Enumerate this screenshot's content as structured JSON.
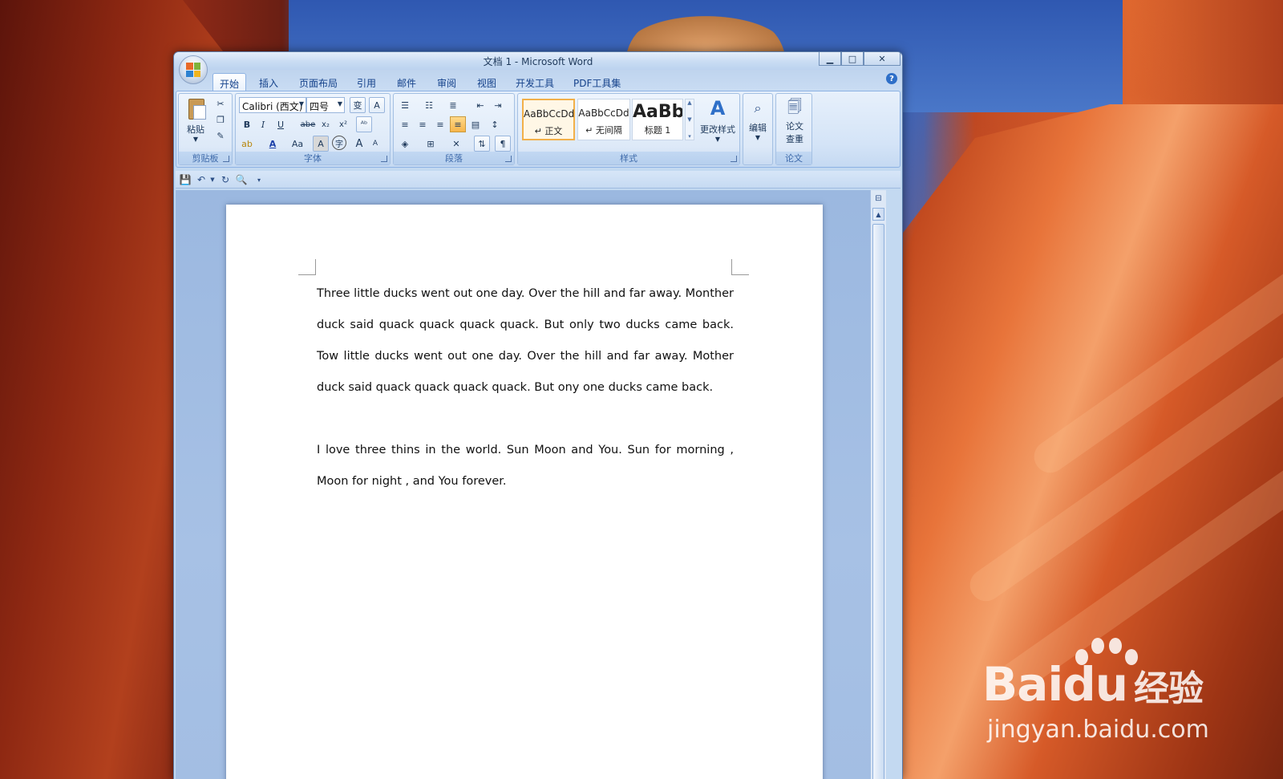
{
  "window": {
    "title": "文档 1 - Microsoft Word"
  },
  "window_controls": {
    "minimize": "▁",
    "maximize": "□",
    "close": "✕"
  },
  "tabs": [
    "开始",
    "插入",
    "页面布局",
    "引用",
    "邮件",
    "审阅",
    "视图",
    "开发工具",
    "PDF工具集"
  ],
  "ribbon": {
    "clipboard": {
      "paste_label": "粘贴",
      "group_label": "剪贴板"
    },
    "font": {
      "font_name": "Calibri (西文)",
      "font_size": "四号",
      "group_label": "字体",
      "bold": "B",
      "italic": "I",
      "underline": "U",
      "strike": "abe",
      "subscript": "x₂",
      "superscript": "x²",
      "font_color": "A",
      "change_case": "Aa",
      "char_shade": "A",
      "enclose": "字",
      "grow": "A",
      "shrink": "A"
    },
    "paragraph": {
      "group_label": "段落"
    },
    "styles": {
      "group_label": "样式",
      "items": [
        {
          "sample": "AaBbCcDd",
          "name": "↵ 正文"
        },
        {
          "sample": "AaBbCcDd",
          "name": "↵ 无间隔"
        },
        {
          "sample": "AaBb",
          "name": "标题 1"
        }
      ],
      "change_styles": "更改样式"
    },
    "editing": {
      "label": "编辑"
    },
    "paper": {
      "check_label_1": "论文",
      "check_label_2": "查重",
      "group_label": "论文"
    }
  },
  "document": {
    "paragraphs": [
      "Three little ducks went out one day. Over the hill and far away. Monther duck said quack quack quack quack. But only two ducks came back. Tow little ducks went out one day. Over the hill and far away. Mother duck said quack quack quack quack. But ony one ducks came back.",
      "",
      "I love three thins in the world. Sun Moon and You. Sun for morning , Moon for night , and You forever."
    ]
  },
  "watermark": {
    "brand": "Bai",
    "brand_du": "du",
    "brand_cn": "经验",
    "url": "jingyan.baidu.com"
  }
}
